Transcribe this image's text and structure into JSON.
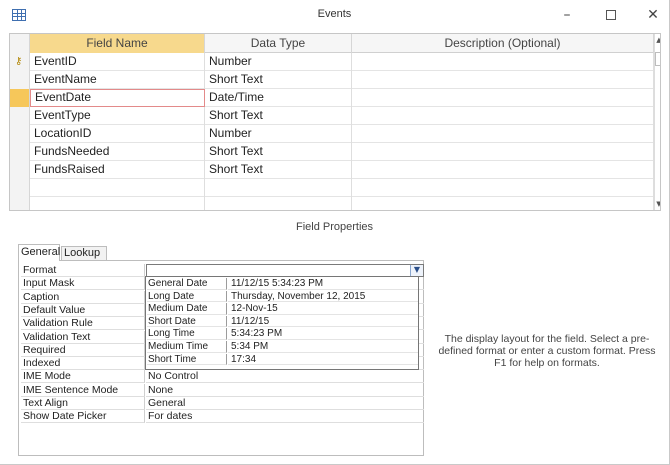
{
  "window": {
    "title": "Events",
    "icon": "table-icon",
    "minimize_glyph": "–",
    "close_glyph": "✕"
  },
  "grid": {
    "headers": {
      "field_name": "Field Name",
      "data_type": "Data Type",
      "description": "Description (Optional)"
    },
    "rows": [
      {
        "name": "EventID",
        "type": "Number",
        "description": "",
        "primary_key": true
      },
      {
        "name": "EventName",
        "type": "Short Text",
        "description": ""
      },
      {
        "name": "EventDate",
        "type": "Date/Time",
        "description": "",
        "current": true
      },
      {
        "name": "EventType",
        "type": "Short Text",
        "description": ""
      },
      {
        "name": "LocationID",
        "type": "Number",
        "description": ""
      },
      {
        "name": "FundsNeeded",
        "type": "Short Text",
        "description": ""
      },
      {
        "name": "FundsRaised",
        "type": "Short Text",
        "description": ""
      },
      {
        "name": "",
        "type": "",
        "description": ""
      },
      {
        "name": "",
        "type": "",
        "description": ""
      },
      {
        "name": "",
        "type": "",
        "description": ""
      }
    ],
    "key_glyph": "⚷",
    "colors": {
      "header_selected": "#f7d98d",
      "current_row": "#f6c75a",
      "active_cell_border": "#e38a8a"
    }
  },
  "field_properties": {
    "title": "Field Properties",
    "tabs": {
      "general": "General",
      "lookup": "Lookup"
    },
    "rows": [
      {
        "label": "Format",
        "value": ""
      },
      {
        "label": "Input Mask",
        "value": ""
      },
      {
        "label": "Caption",
        "value": ""
      },
      {
        "label": "Default Value",
        "value": ""
      },
      {
        "label": "Validation Rule",
        "value": ""
      },
      {
        "label": "Validation Text",
        "value": ""
      },
      {
        "label": "Required",
        "value": ""
      },
      {
        "label": "Indexed",
        "value": "No"
      },
      {
        "label": "IME Mode",
        "value": "No Control"
      },
      {
        "label": "IME Sentence Mode",
        "value": "None"
      },
      {
        "label": "Text Align",
        "value": "General"
      },
      {
        "label": "Show Date Picker",
        "value": "For dates"
      }
    ],
    "format_dropdown": {
      "arrow_glyph": "▼",
      "options": [
        {
          "name": "General Date",
          "example": "11/12/15 5:34:23 PM"
        },
        {
          "name": "Long Date",
          "example": "Thursday, November 12, 2015"
        },
        {
          "name": "Medium Date",
          "example": "12-Nov-15"
        },
        {
          "name": "Short Date",
          "example": "11/12/15"
        },
        {
          "name": "Long Time",
          "example": "5:34:23 PM"
        },
        {
          "name": "Medium Time",
          "example": "5:34 PM"
        },
        {
          "name": "Short Time",
          "example": "17:34"
        }
      ]
    },
    "help_text": "The display layout for the field. Select a pre-defined format or enter a custom format. Press F1 for help on formats."
  }
}
